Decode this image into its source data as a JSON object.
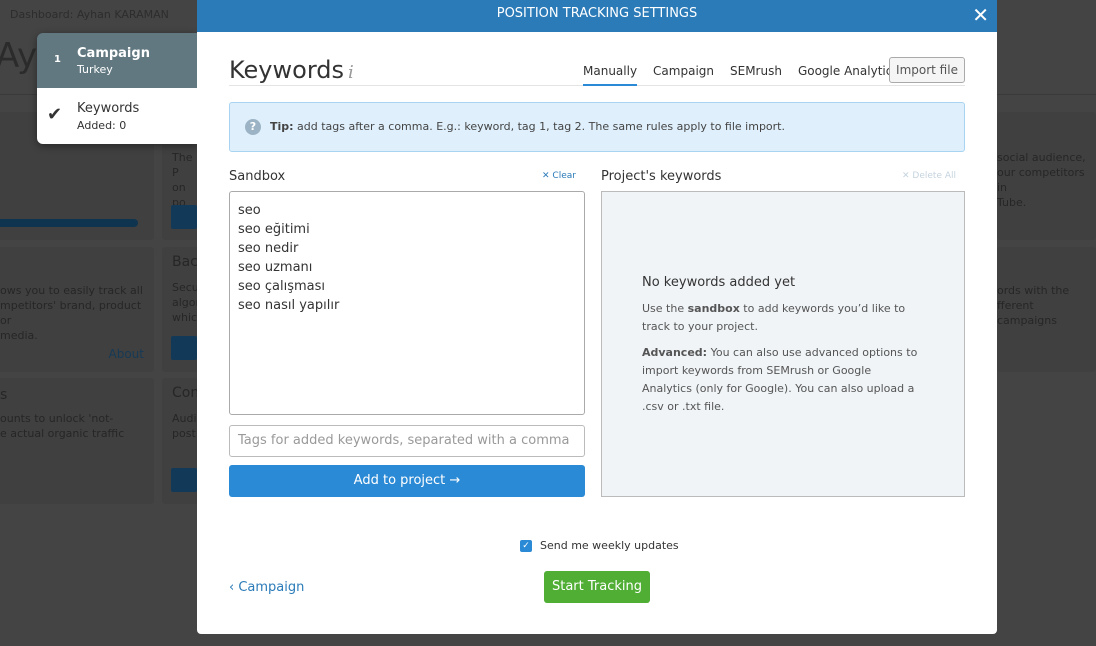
{
  "background": {
    "breadcrumb": "Dashboard: Ayhan KARAMAN",
    "page_title_fragment": "Ay",
    "card_texts": [
      "ows you to easily track all",
      "mpetitors' brand, product or",
      "media.",
      "About",
      "s",
      "ounts to unlock 'not-",
      "e actual organic traffic",
      "The P",
      "on po",
      "resul",
      "Back",
      "Secur",
      "algor",
      "whic",
      "Con",
      "Audi",
      "post",
      "social audience,",
      "our competitors in",
      "Tube.",
      "ords with the",
      "fferent campaigns"
    ]
  },
  "steps": [
    {
      "number": "1",
      "title": "Campaign",
      "subtitle": "Turkey"
    },
    {
      "title": "Keywords",
      "subtitle": "Added: 0"
    }
  ],
  "modal": {
    "header": "POSITION TRACKING SETTINGS",
    "close": "✕",
    "title": "Keywords",
    "info_icon": "i",
    "tabs": [
      {
        "label": "Manually",
        "active": true
      },
      {
        "label": "Campaign"
      },
      {
        "label": "SEMrush"
      },
      {
        "label": "Google Analytics"
      }
    ],
    "import_file": "Import file",
    "tip": {
      "bold": "Tip:",
      "text": " add tags after a comma. E.g.: keyword, tag 1, tag 2. The same rules apply to file import."
    },
    "sandbox": {
      "label": "Sandbox",
      "clear": "Clear",
      "keywords": [
        "seo",
        "seo eğitimi",
        "seo nedir",
        "seo uzmanı",
        "seo çalışması",
        "seo nasıl yapılır"
      ]
    },
    "tags_placeholder": "Tags for added keywords, separated with a comma",
    "add_button": "Add to project",
    "project": {
      "label": "Project's keywords",
      "delete_all": "Delete All",
      "empty_title": "No keywords added yet",
      "p1_a": "Use the ",
      "p1_b": "sandbox",
      "p1_c": " to add keywords you’d like to track to your project.",
      "p2_a": "Advanced:",
      "p2_b": " You can also use advanced options to import keywords from SEMrush or Google Analytics (only for Google). You can also upload a .csv or .txt file."
    },
    "weekly": {
      "label": "Send me weekly updates",
      "checked": true
    },
    "back": "Campaign",
    "start": "Start Tracking"
  },
  "colors": {
    "header": "#2b7bb9",
    "primary": "#2b8ad5",
    "start": "#4fae33",
    "tip_bg": "#dff0fc"
  }
}
